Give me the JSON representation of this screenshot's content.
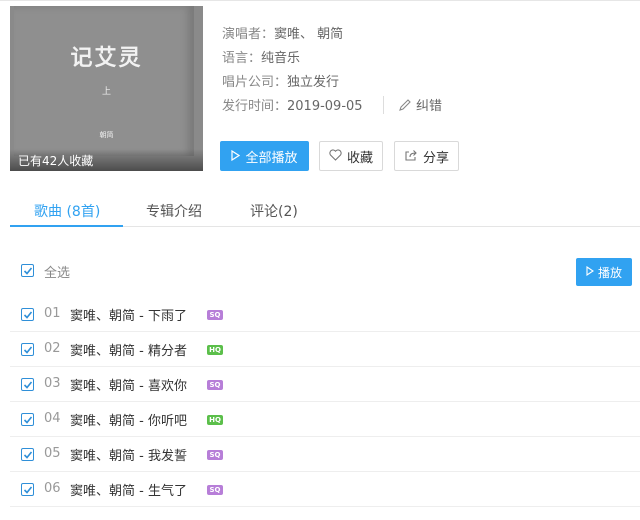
{
  "album": {
    "cover": {
      "title": "记艾灵",
      "sub": "上",
      "artist": "朝简",
      "fav_count_text": "已有42人收藏"
    },
    "meta": {
      "singer_label": "演唱者：",
      "singer_value": "窦唯、 朝简",
      "language_label": "语言：",
      "language_value": "纯音乐",
      "company_label": "唱片公司：",
      "company_value": "独立发行",
      "release_label": "发行时间：",
      "release_value": "2019-09-05",
      "report_label": "纠错"
    },
    "buttons": {
      "play_all": "全部播放",
      "favorite": "收藏",
      "share": "分享"
    }
  },
  "tabs": [
    {
      "label": "歌曲 (8首)",
      "active": true
    },
    {
      "label": "专辑介绍",
      "active": false
    },
    {
      "label": "评论(2)",
      "active": false
    }
  ],
  "list": {
    "select_all_label": "全选",
    "play_button": "播放",
    "songs": [
      {
        "num": "01",
        "title": "窦唯、朝简 - 下雨了",
        "quality": "SQ"
      },
      {
        "num": "02",
        "title": "窦唯、朝简 - 精分者",
        "quality": "HQ"
      },
      {
        "num": "03",
        "title": "窦唯、朝简 - 喜欢你",
        "quality": "SQ"
      },
      {
        "num": "04",
        "title": "窦唯、朝简 - 你听吧",
        "quality": "HQ"
      },
      {
        "num": "05",
        "title": "窦唯、朝简 - 我发誓",
        "quality": "SQ"
      },
      {
        "num": "06",
        "title": "窦唯、朝简 - 生气了",
        "quality": "SQ"
      }
    ]
  },
  "colors": {
    "accent": "#31a2f1",
    "sq_badge": "#b77ed8",
    "hq_badge": "#5bbf4a"
  }
}
